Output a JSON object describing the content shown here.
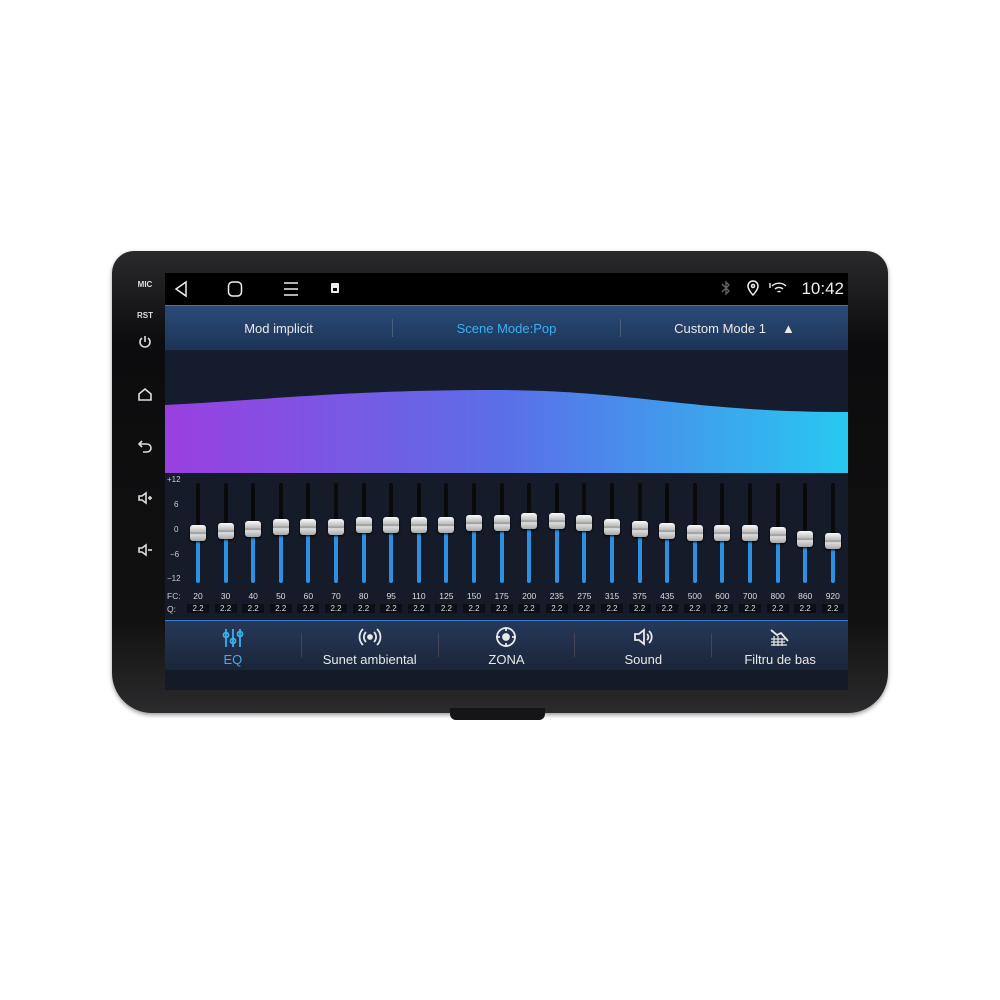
{
  "device": {
    "side_labels": [
      "MIC",
      "RST"
    ],
    "side_icons": [
      "power-icon",
      "home-icon",
      "back-icon",
      "volume-up-icon",
      "volume-down-icon"
    ]
  },
  "status": {
    "time": "10:42",
    "icons": [
      "back-icon",
      "home-icon",
      "menu-icon",
      "notification-icon",
      "bluetooth-icon",
      "location-icon",
      "wifi-icon"
    ]
  },
  "header": {
    "default_mode": "Mod implicit",
    "scene_mode": "Scene Mode:Pop",
    "custom_mode": "Custom Mode 1",
    "scene_color": "#3ab0ee"
  },
  "eq": {
    "y_labels": [
      "+12",
      "6",
      "0",
      "−6",
      "−12"
    ],
    "fc_label": "FC:",
    "q_label": "Q:",
    "range": [
      -12,
      12
    ],
    "bands": [
      {
        "fc": "20",
        "q": "2.2",
        "gain": 0
      },
      {
        "fc": "30",
        "q": "2.2",
        "gain": 0.5
      },
      {
        "fc": "40",
        "q": "2.2",
        "gain": 1
      },
      {
        "fc": "50",
        "q": "2.2",
        "gain": 1.5
      },
      {
        "fc": "60",
        "q": "2.2",
        "gain": 1.5
      },
      {
        "fc": "70",
        "q": "2.2",
        "gain": 1.5
      },
      {
        "fc": "80",
        "q": "2.2",
        "gain": 2
      },
      {
        "fc": "95",
        "q": "2.2",
        "gain": 2
      },
      {
        "fc": "110",
        "q": "2.2",
        "gain": 2
      },
      {
        "fc": "125",
        "q": "2.2",
        "gain": 2
      },
      {
        "fc": "150",
        "q": "2.2",
        "gain": 2.5
      },
      {
        "fc": "175",
        "q": "2.2",
        "gain": 2.5
      },
      {
        "fc": "200",
        "q": "2.2",
        "gain": 3
      },
      {
        "fc": "235",
        "q": "2.2",
        "gain": 3
      },
      {
        "fc": "275",
        "q": "2.2",
        "gain": 2.5
      },
      {
        "fc": "315",
        "q": "2.2",
        "gain": 1.5
      },
      {
        "fc": "375",
        "q": "2.2",
        "gain": 1
      },
      {
        "fc": "435",
        "q": "2.2",
        "gain": 0.5
      },
      {
        "fc": "500",
        "q": "2.2",
        "gain": 0
      },
      {
        "fc": "600",
        "q": "2.2",
        "gain": 0
      },
      {
        "fc": "700",
        "q": "2.2",
        "gain": 0
      },
      {
        "fc": "800",
        "q": "2.2",
        "gain": -0.5
      },
      {
        "fc": "860",
        "q": "2.2",
        "gain": -1.5
      },
      {
        "fc": "920",
        "q": "2.2",
        "gain": -2
      }
    ]
  },
  "tabs": [
    {
      "label": "EQ",
      "icon": "equalizer-icon",
      "active": true
    },
    {
      "label": "Sunet ambiental",
      "icon": "surround-icon"
    },
    {
      "label": "ZONA",
      "icon": "zone-target-icon"
    },
    {
      "label": "Sound",
      "icon": "speaker-icon"
    },
    {
      "label": "Filtru de bas",
      "icon": "bass-filter-icon"
    }
  ]
}
